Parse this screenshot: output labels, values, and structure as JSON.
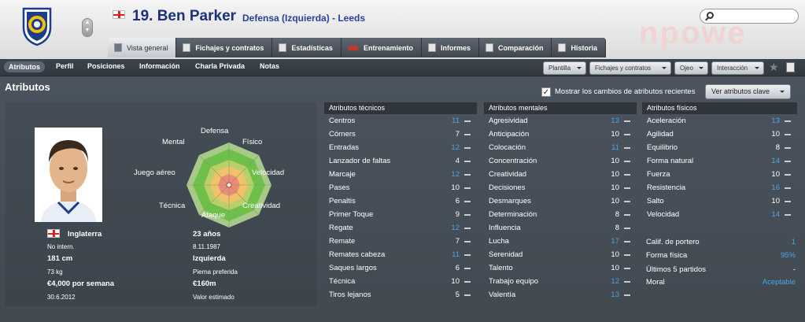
{
  "header": {
    "player_name": "19. Ben Parker",
    "position_club": "Defensa (Izquierda) - Leeds",
    "watermark_text": "npowe",
    "search_placeholder": ""
  },
  "tabs": [
    {
      "label": "Vista general",
      "icon": "overview-icon",
      "active": true
    },
    {
      "label": "Fichajes y contratos",
      "icon": "document-icon"
    },
    {
      "label": "Estadísticas",
      "icon": "stats-icon"
    },
    {
      "label": "Entrenamiento",
      "icon": "training-icon"
    },
    {
      "label": "Informes",
      "icon": "report-icon"
    },
    {
      "label": "Comparación",
      "icon": "compare-icon"
    },
    {
      "label": "Historia",
      "icon": "history-icon"
    }
  ],
  "subnav": {
    "items": [
      "Atributos",
      "Perfil",
      "Posiciones",
      "Información",
      "Charla Privada",
      "Notas"
    ],
    "dropdowns": [
      "Plantilla",
      "Fichajes y contratos",
      "Ojeo",
      "Interacción"
    ]
  },
  "main": {
    "section_title": "Atributos",
    "show_changes_label": "Mostrar los cambios de atributos recientes",
    "show_changes_checked": true,
    "key_attributes_button": "Ver atributos clave"
  },
  "radar_labels": {
    "defensa": "Defensa",
    "fisico": "Físico",
    "velocidad": "Velocidad",
    "creatividad": "Creatividad",
    "ataque": "Ataque",
    "tecnica": "Técnica",
    "juego_aereo": "Juego aéreo",
    "mental": "Mental"
  },
  "bio": {
    "nationality": "Inglaterra",
    "age": "23 años",
    "caps": "No intern.",
    "dob": "8.11.1987",
    "height": "181 cm",
    "foot": "Izquierda",
    "weight": "73 kg",
    "foot_label": "Pierna preferida",
    "wage": "€4,000 por semana",
    "value": "€160m",
    "contract_end": "30.6.2012",
    "value_label": "Valor estimado"
  },
  "technical": {
    "title": "Atributos técnicos",
    "rows": [
      {
        "name": "Centros",
        "value": "11",
        "blue": true
      },
      {
        "name": "Córners",
        "value": "7"
      },
      {
        "name": "Entradas",
        "value": "12",
        "blue": true
      },
      {
        "name": "Lanzador de faltas",
        "value": "4"
      },
      {
        "name": "Marcaje",
        "value": "12",
        "blue": true
      },
      {
        "name": "Pases",
        "value": "10"
      },
      {
        "name": "Penaltis",
        "value": "6"
      },
      {
        "name": "Primer Toque",
        "value": "9"
      },
      {
        "name": "Regate",
        "value": "12",
        "blue": true
      },
      {
        "name": "Remate",
        "value": "7"
      },
      {
        "name": "Remates cabeza",
        "value": "11",
        "blue": true
      },
      {
        "name": "Saques largos",
        "value": "6"
      },
      {
        "name": "Técnica",
        "value": "10"
      },
      {
        "name": "Tiros lejanos",
        "value": "5"
      }
    ]
  },
  "mental": {
    "title": "Atributos mentales",
    "rows": [
      {
        "name": "Agresividad",
        "value": "13",
        "blue": true
      },
      {
        "name": "Anticipación",
        "value": "10"
      },
      {
        "name": "Colocación",
        "value": "11",
        "blue": true
      },
      {
        "name": "Concentración",
        "value": "10"
      },
      {
        "name": "Creatividad",
        "value": "10"
      },
      {
        "name": "Decisiones",
        "value": "10"
      },
      {
        "name": "Desmarques",
        "value": "10"
      },
      {
        "name": "Determinación",
        "value": "8"
      },
      {
        "name": "Influencia",
        "value": "8"
      },
      {
        "name": "Lucha",
        "value": "17",
        "blue": true
      },
      {
        "name": "Serenidad",
        "value": "10"
      },
      {
        "name": "Talento",
        "value": "10"
      },
      {
        "name": "Trabajo equipo",
        "value": "12",
        "blue": true
      },
      {
        "name": "Valentía",
        "value": "13",
        "blue": true
      }
    ]
  },
  "physical": {
    "title": "Atributos físicos",
    "rows": [
      {
        "name": "Aceleración",
        "value": "13",
        "blue": true
      },
      {
        "name": "Agilidad",
        "value": "10"
      },
      {
        "name": "Equilibrio",
        "value": "8"
      },
      {
        "name": "Forma natural",
        "value": "14",
        "blue": true
      },
      {
        "name": "Fuerza",
        "value": "10"
      },
      {
        "name": "Resistencia",
        "value": "16",
        "blue": true
      },
      {
        "name": "Salto",
        "value": "10"
      },
      {
        "name": "Velocidad",
        "value": "14",
        "blue": true
      }
    ]
  },
  "extra": [
    {
      "name": "Calif. de portero",
      "value": "1",
      "blue": true
    },
    {
      "name": "Forma física",
      "value": "95%",
      "blue": true
    },
    {
      "name": "Últimos 5 partidos",
      "value": "-"
    },
    {
      "name": "Moral",
      "value": "Aceptable",
      "blue": true
    }
  ]
}
